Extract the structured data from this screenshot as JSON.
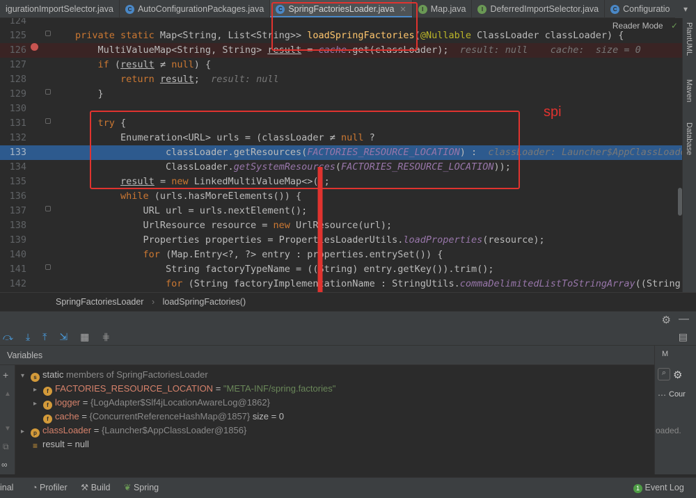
{
  "tabs": [
    {
      "label": "igurationImportSelector.java",
      "icon": "",
      "color": ""
    },
    {
      "label": "AutoConfigurationPackages.java",
      "icon": "C",
      "color": "#4a88c7"
    },
    {
      "label": "SpringFactoriesLoader.java",
      "icon": "C",
      "color": "#4a88c7"
    },
    {
      "label": "Map.java",
      "icon": "I",
      "color": "#6a9955"
    },
    {
      "label": "DeferredImportSelector.java",
      "icon": "I",
      "color": "#6a9955"
    },
    {
      "label": "Configuratio",
      "icon": "C",
      "color": "#4a88c7"
    }
  ],
  "right_tools": [
    "PlantUML",
    "Maven",
    "Database"
  ],
  "reader_mode": "Reader Mode",
  "annotation": "spi",
  "code": {
    "lines": [
      {
        "n": "124",
        "html": ""
      },
      {
        "n": "125",
        "html": "<span class='kw'>private static</span> Map&lt;String, List&lt;String&gt;&gt; <span class='fn'>loadSpringFactories</span>(<span class='ann'>@Nullable</span> ClassLoader classLoader) {"
      },
      {
        "n": "126",
        "html": "    MultiValueMap&lt;String, String&gt; <u>result</u> = <span class='it'>cache</span>.get(classLoader);  <span class='hint'>result: null    cache:  size = 0</span>"
      },
      {
        "n": "127",
        "html": "    <span class='kw'>if</span> (<u>result</u> ≠ <span class='kw'>null</span>) {"
      },
      {
        "n": "128",
        "html": "        <span class='kw'>return</span> <u>result</u>;  <span class='hint'>result: null</span>"
      },
      {
        "n": "129",
        "html": "    }"
      },
      {
        "n": "130",
        "html": ""
      },
      {
        "n": "131",
        "html": "    <span class='kw'>try</span> {"
      },
      {
        "n": "132",
        "html": "        Enumeration&lt;URL&gt; urls = (classLoader ≠ <span class='kw'>null</span> ?"
      },
      {
        "n": "133",
        "html": "                classLoader.getResources(<span class='st'>FACTORIES_RESOURCE_LOCATION</span>) :  <span class='hint'>classLoader: Launcher$AppClassLoader</span>"
      },
      {
        "n": "134",
        "html": "                ClassLoader.<span class='it'>getSystemResources</span>(<span class='st'>FACTORIES_RESOURCE_LOCATION</span>));"
      },
      {
        "n": "135",
        "html": "        <u>result</u> = <span class='kw'>new</span> LinkedMultiValueMap&lt;&gt;();"
      },
      {
        "n": "136",
        "html": "        <span class='kw'>while</span> (urls.hasMoreElements()) {"
      },
      {
        "n": "137",
        "html": "            URL url = urls.nextElement();"
      },
      {
        "n": "138",
        "html": "            UrlResource resource = <span class='kw'>new</span> UrlResource(url);"
      },
      {
        "n": "139",
        "html": "            Properties properties = PropertiesLoaderUtils.<span class='it'>loadProperties</span>(resource);"
      },
      {
        "n": "140",
        "html": "            <span class='kw'>for</span> (Map.Entry&lt;?, ?&gt; entry : properties.entrySet()) {"
      },
      {
        "n": "141",
        "html": "                String factoryTypeName = ((String) entry.getKey()).trim();"
      },
      {
        "n": "142",
        "html": "                <span class='kw'>for</span> (String factoryImplementationName : StringUtils.<span class='it'>commaDelimitedListToStringArray</span>((String)"
      }
    ]
  },
  "breadcrumb": [
    "SpringFactoriesLoader",
    "loadSpringFactories()"
  ],
  "variables_title": "Variables",
  "variables": [
    {
      "arrow": "▾",
      "badge": "s",
      "badge_color": "#d39a3a",
      "name": "static",
      "rest": " members of SpringFactoriesLoader"
    },
    {
      "arrow": "▸",
      "badge": "f",
      "badge_color": "#d39a3a",
      "name": "FACTORIES_RESOURCE_LOCATION",
      "eq": " = ",
      "value": "\"META-INF/spring.factories\""
    },
    {
      "arrow": "▸",
      "badge": "f",
      "badge_color": "#d39a3a",
      "name": "logger",
      "eq": " = ",
      "value": "{LogAdapter$Slf4jLocationAwareLog@1862}"
    },
    {
      "arrow": "",
      "badge": "f",
      "badge_color": "#d39a3a",
      "name": "cache",
      "eq": " = ",
      "value": "{ConcurrentReferenceHashMap@1857}",
      "extra": "  size = 0"
    },
    {
      "arrow": "▸",
      "badge": "p",
      "badge_color": "#d39a3a",
      "name": "classLoader",
      "eq": " = ",
      "value": "{Launcher$AppClassLoader@1856}"
    },
    {
      "arrow": "",
      "badge": "≡",
      "badge_color": "",
      "name": "result",
      "eq": " = ",
      "value": "null"
    }
  ],
  "right_panel": {
    "tab": "M",
    "label": "Cour",
    "loaded": "oaded."
  },
  "status": {
    "terminal": "inal",
    "profiler": "Profiler",
    "build": "Build",
    "spring": "Spring",
    "event_log": "Event Log",
    "event_count": "1"
  }
}
